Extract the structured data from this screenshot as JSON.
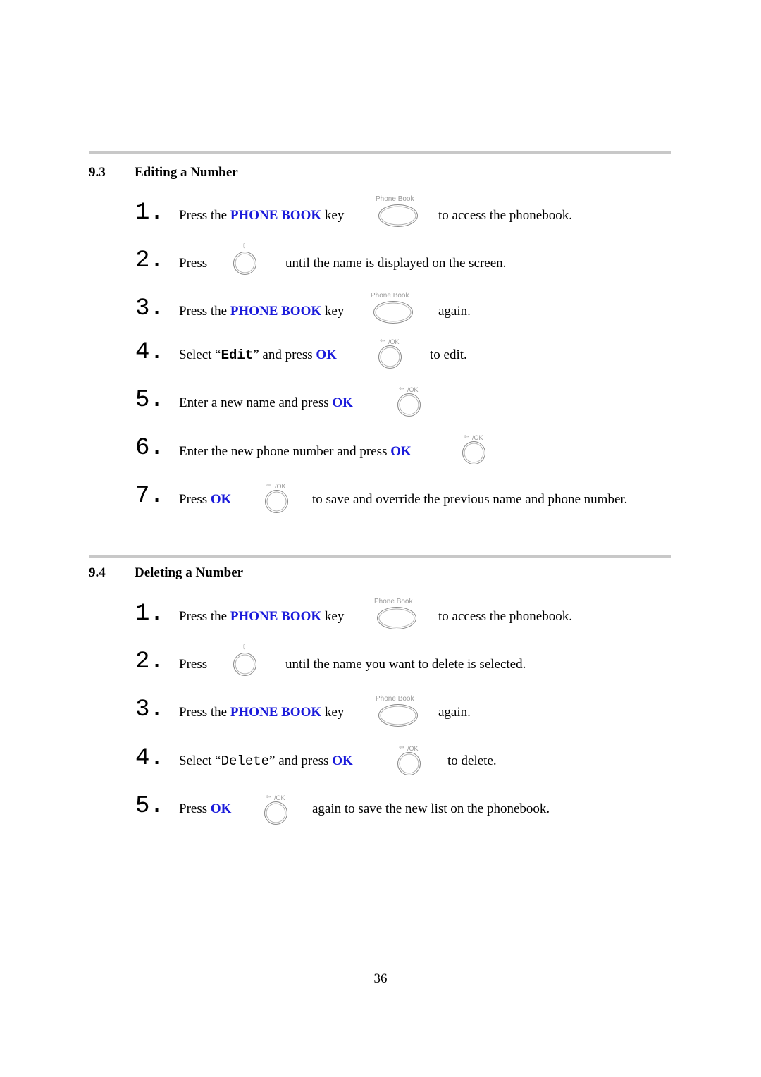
{
  "sections": [
    {
      "number": "9.3",
      "title": "Editing a Number",
      "steps": [
        {
          "num": "1.",
          "pre": "Press the ",
          "highlight": "PHONE BOOK",
          "mid": " key",
          "key": "phone-book",
          "post": "to access the phonebook."
        },
        {
          "num": "2.",
          "pre": "Press",
          "key": "scroll",
          "post": "until the name is displayed on the screen."
        },
        {
          "num": "3.",
          "pre": "Press the ",
          "highlight": "PHONE BOOK",
          "mid": " key",
          "key": "phone-book",
          "post": "again."
        },
        {
          "num": "4.",
          "pre": "Select “",
          "code": "Edit",
          "pre2": "” and press ",
          "highlight": "OK",
          "key": "ok",
          "post": "to edit."
        },
        {
          "num": "5.",
          "pre": "Enter a new name and press ",
          "highlight": "OK",
          "key": "ok"
        },
        {
          "num": "6.",
          "pre": "Enter the new phone number and press ",
          "highlight": "OK",
          "key": "ok"
        },
        {
          "num": "7.",
          "pre": "Press ",
          "highlight": "OK",
          "key": "ok",
          "post": "to save and override the previous name and phone number."
        }
      ]
    },
    {
      "number": "9.4",
      "title": "Deleting a Number",
      "steps": [
        {
          "num": "1.",
          "pre": "Press the ",
          "highlight": "PHONE BOOK",
          "mid": " key",
          "key": "phone-book",
          "post": "to access the phonebook."
        },
        {
          "num": "2.",
          "pre": "Press",
          "key": "scroll",
          "post": "until the name you want to delete is selected."
        },
        {
          "num": "3.",
          "pre": "Press the ",
          "highlight": "PHONE BOOK",
          "mid": " key",
          "key": "phone-book",
          "post": "again."
        },
        {
          "num": "4.",
          "pre": "Select “",
          "code": "Delete",
          "pre2": "” and press ",
          "highlight": "OK",
          "key": "ok",
          "post": "to delete."
        },
        {
          "num": "5.",
          "pre": "Press ",
          "highlight": "OK",
          "key": "ok",
          "post": "again to save the new list on the phonebook."
        }
      ]
    }
  ],
  "keys": {
    "phone_book_label": "Phone Book",
    "ok_label": "/OK",
    "ok_arrow": "⇦",
    "scroll_arrow": "⇩"
  },
  "colors": {
    "highlight": "#1a1adb",
    "rule": "#c8c8c8"
  },
  "page_number": "36"
}
